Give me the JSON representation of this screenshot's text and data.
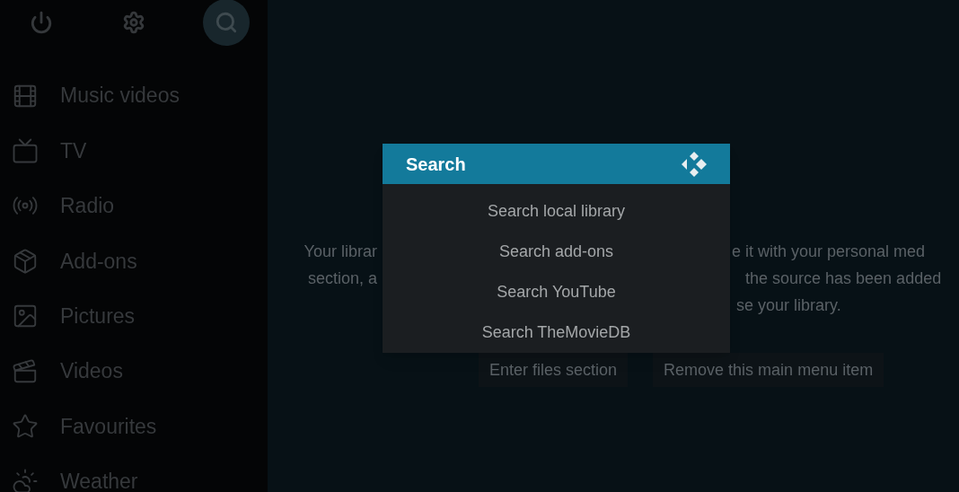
{
  "top_bar": [
    {
      "selected": false
    },
    {
      "selected": false
    },
    {
      "selected": true
    }
  ],
  "sidebar": {
    "items": [
      {
        "label": "Music videos"
      },
      {
        "label": "TV"
      },
      {
        "label": "Radio"
      },
      {
        "label": "Add-ons"
      },
      {
        "label": "Pictures"
      },
      {
        "label": "Videos"
      },
      {
        "label": "Favourites"
      },
      {
        "label": "Weather"
      }
    ]
  },
  "background_message": {
    "lines": [
      {
        "left": "Your librar",
        "right": "e it with your personal med"
      },
      {
        "left": "section, a",
        "right": "the source has been added"
      },
      {
        "right": "se your library."
      }
    ],
    "buttons": [
      "Enter files section",
      "Remove this main menu item"
    ]
  },
  "dialog": {
    "title": "Search",
    "items": [
      "Search local library",
      "Search add-ons",
      "Search YouTube",
      "Search TheMovieDB"
    ]
  }
}
